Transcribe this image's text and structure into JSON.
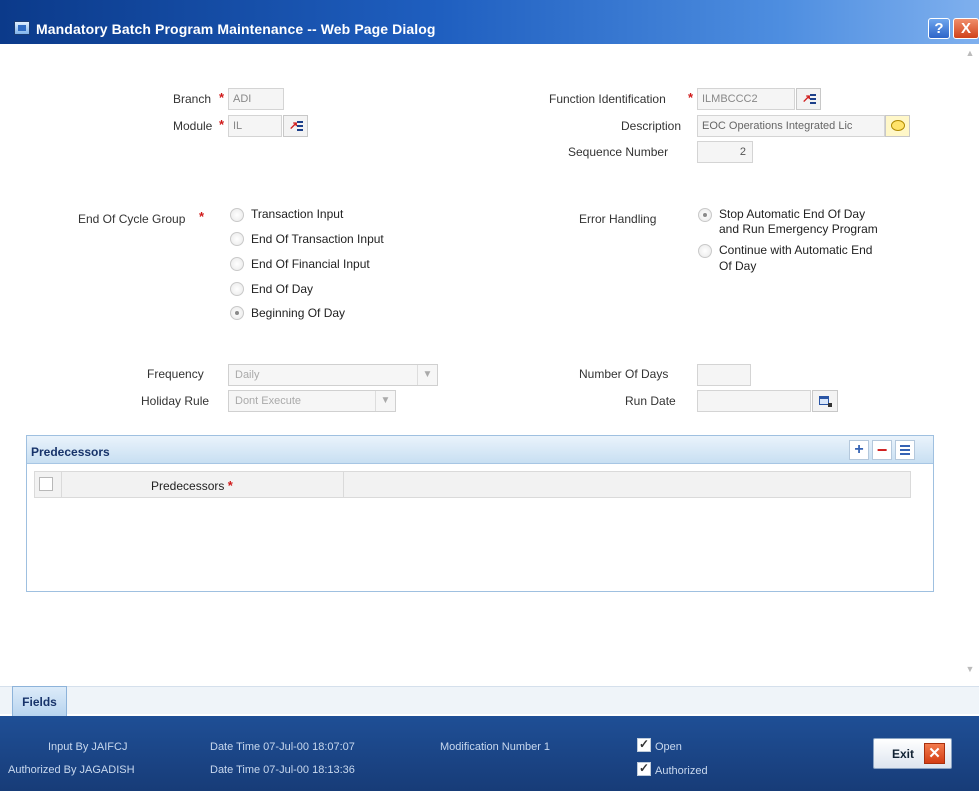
{
  "window": {
    "title": "Mandatory Batch Program Maintenance -- Web Page Dialog",
    "help_label": "?",
    "close_label": "X"
  },
  "form": {
    "branch": {
      "label": "Branch",
      "value": "ADI"
    },
    "module": {
      "label": "Module",
      "value": "IL"
    },
    "function_id": {
      "label": "Function Identification",
      "value": "ILMBCCC2"
    },
    "description": {
      "label": "Description",
      "value": "EOC Operations Integrated Lic"
    },
    "sequence_number": {
      "label": "Sequence Number",
      "value": "2"
    },
    "end_of_cycle_group": {
      "label": "End Of Cycle Group",
      "options": [
        "Transaction Input",
        "End Of Transaction Input",
        "End Of Financial Input",
        "End Of Day",
        "Beginning Of Day"
      ],
      "selected": "Beginning Of Day"
    },
    "error_handling": {
      "label": "Error Handling",
      "options": [
        {
          "line1": "Stop Automatic End Of Day",
          "line2": "and Run Emergency Program"
        },
        {
          "line1": "Continue with Automatic End",
          "line2": "Of Day"
        }
      ],
      "selected": "Stop Automatic End Of Day and Run Emergency Program"
    },
    "frequency": {
      "label": "Frequency",
      "value": "Daily"
    },
    "holiday_rule": {
      "label": "Holiday Rule",
      "value": "Dont Execute"
    },
    "number_of_days": {
      "label": "Number Of Days",
      "value": ""
    },
    "run_date": {
      "label": "Run Date",
      "value": ""
    }
  },
  "predecessors": {
    "title": "Predecessors",
    "column": "Predecessors",
    "add_label": "+",
    "delete_label": "−",
    "rows": []
  },
  "tabs": [
    "Fields"
  ],
  "footer": {
    "input_by": "Input By JAIFCJ",
    "input_datetime": "Date Time 07-Jul-00 18:07:07",
    "modification_number": "Modification Number 1",
    "open_label": "Open",
    "authorized_by": "Authorized By JAGADISH",
    "auth_datetime": "Date Time 07-Jul-00 18:13:36",
    "authorized_label": "Authorized",
    "exit_label": "Exit"
  },
  "required_marker": "*",
  "icons": {
    "lov": "list-of-values-icon",
    "calendar": "calendar-icon",
    "description_popup": "comment-icon"
  }
}
